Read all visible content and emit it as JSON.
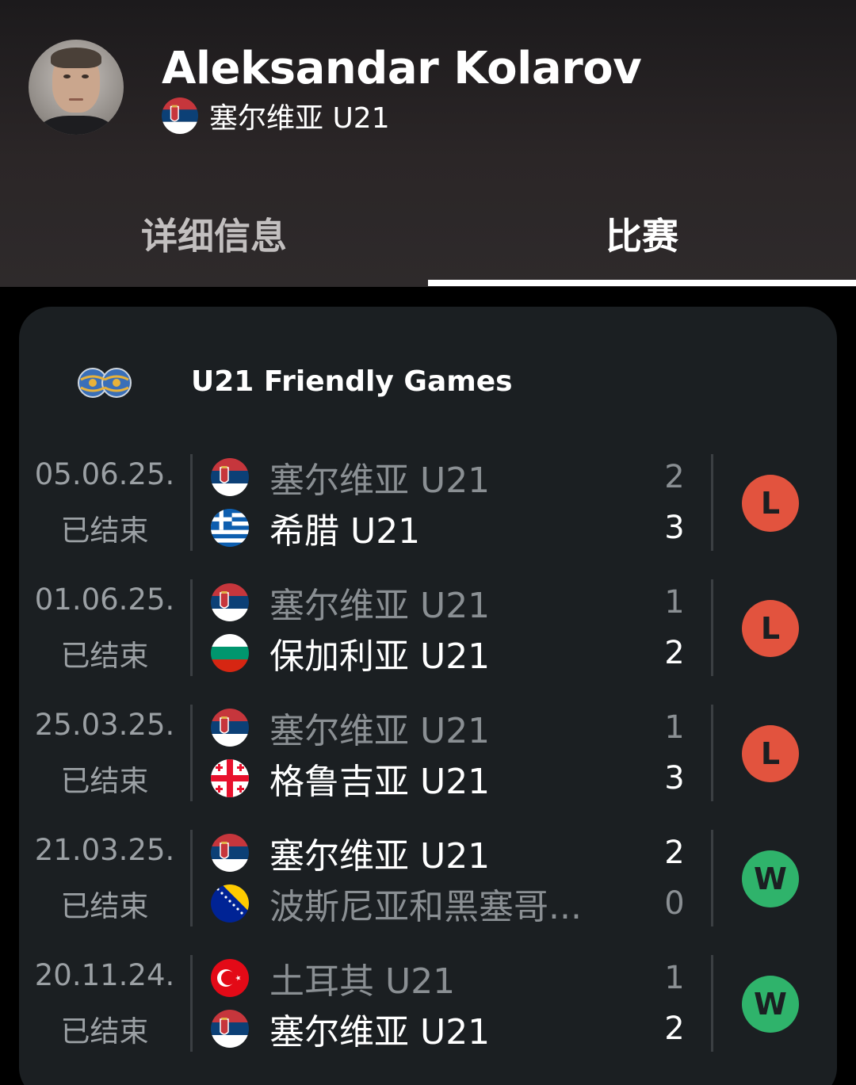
{
  "header": {
    "coach_name": "Aleksandar Kolarov",
    "team_name": "塞尔维亚 U21",
    "team_flag": "serbia-flag"
  },
  "tabs": [
    {
      "label": "详细信息",
      "active": false
    },
    {
      "label": "比赛",
      "active": true
    }
  ],
  "competition": {
    "name": "U21 Friendly Games",
    "icon": "friendly-games-icon"
  },
  "colors": {
    "loss": "#e2533e",
    "win": "#2fb36b"
  },
  "matches": [
    {
      "date": "05.06.25.",
      "status": "已结束",
      "home": {
        "name": "塞尔维亚 U21",
        "flag": "serbia-flag",
        "score": "2",
        "winner": false
      },
      "away": {
        "name": "希腊 U21",
        "flag": "greece-flag",
        "score": "3",
        "winner": true
      },
      "result": "L"
    },
    {
      "date": "01.06.25.",
      "status": "已结束",
      "home": {
        "name": "塞尔维亚 U21",
        "flag": "serbia-flag",
        "score": "1",
        "winner": false
      },
      "away": {
        "name": "保加利亚 U21",
        "flag": "bulgaria-flag",
        "score": "2",
        "winner": true
      },
      "result": "L"
    },
    {
      "date": "25.03.25.",
      "status": "已结束",
      "home": {
        "name": "塞尔维亚 U21",
        "flag": "serbia-flag",
        "score": "1",
        "winner": false
      },
      "away": {
        "name": "格鲁吉亚 U21",
        "flag": "georgia-flag",
        "score": "3",
        "winner": true
      },
      "result": "L"
    },
    {
      "date": "21.03.25.",
      "status": "已结束",
      "home": {
        "name": "塞尔维亚 U21",
        "flag": "serbia-flag",
        "score": "2",
        "winner": true
      },
      "away": {
        "name": "波斯尼亚和黑塞哥...",
        "flag": "bosnia-flag",
        "score": "0",
        "winner": false
      },
      "result": "W"
    },
    {
      "date": "20.11.24.",
      "status": "已结束",
      "home": {
        "name": "土耳其 U21",
        "flag": "turkey-flag",
        "score": "1",
        "winner": false
      },
      "away": {
        "name": "塞尔维亚 U21",
        "flag": "serbia-flag",
        "score": "2",
        "winner": true
      },
      "result": "W"
    }
  ]
}
